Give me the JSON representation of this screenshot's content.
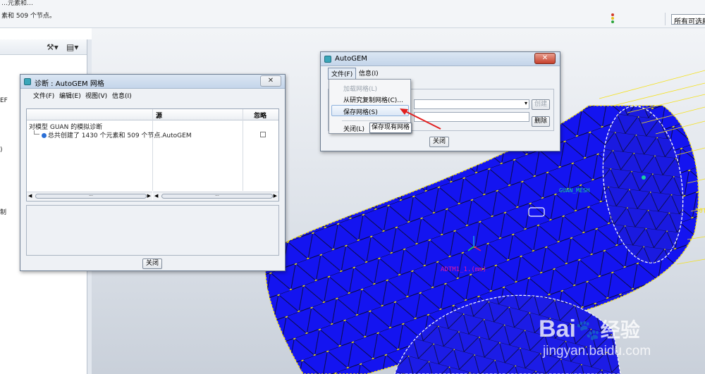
{
  "topbar": {
    "message_top": "…元素和…",
    "message_status": "素和 509 个节点。",
    "filter_value": "所有可选助"
  },
  "model_tree": {
    "fragments": [
      "EF",
      ")",
      "制"
    ]
  },
  "viewport": {
    "label_mesh": "GUAN_MESH",
    "label_dim": "ADTM1_1.(mm)",
    "label_right": "50(",
    "colors": {
      "mesh_fill": "#1414f0",
      "mesh_line": "#0a0a30",
      "node": "#f5e11a",
      "annotation": "#e01aa0"
    }
  },
  "diagnostics": {
    "title": "诊断 : AutoGEM 网格",
    "menu": [
      "文件(F)",
      "编辑(E)",
      "视图(V)",
      "信息(I)"
    ],
    "columns": [
      "",
      "源",
      "忽略"
    ],
    "root_row": "对模型 GUAN 的模拟诊断",
    "child_row": "总共创建了 1430 个元素和 509 个节点.",
    "child_source": "AutoGEM",
    "scroll_glyph": "···",
    "close_label": "关闭"
  },
  "autogem": {
    "title": "AutoGEM",
    "menu": [
      "文件(F)",
      "信息(I)"
    ],
    "create_label": "创建",
    "delete_label": "删除",
    "close_label": "关闭",
    "close_x": "✕"
  },
  "file_menu": {
    "items": [
      "加载网格(L)",
      "从研究复制网格(C)...",
      "保存网格(S)",
      "关闭(L)"
    ],
    "tooltip": "保存现有网格"
  },
  "watermark": {
    "brand_a": "Bai",
    "brand_b": "经验",
    "url": "jingyan.baidu.com"
  }
}
